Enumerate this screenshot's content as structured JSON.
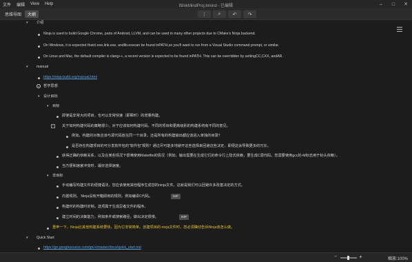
{
  "menubar": {
    "items": [
      "文件",
      "编辑",
      "View",
      "Help"
    ],
    "title": "BlinkMindProj.bmind - 已编辑"
  },
  "toolbar": {
    "tab_mindmap": "思维导图",
    "tab_outline": "大纲"
  },
  "outline": {
    "intro_title": "介绍",
    "intro_lines": [
      "Ninja is used to build Google Chrome, parts of Android, LLVM, and can be used in many other projects due to CMake's Ninja backend.",
      "On Windows, it is expected thatcl.exe,link.exe, andlib.execan be found inPATH,so you'll want to run from a Visual Studio command prompt, or similar.",
      "On Linux and Mac, the default compiler is clang++, a recent version is expected to be found inPATH. This can be overridden by settingCC,CXX, andAR."
    ],
    "manual_title": "manual",
    "manual_link": "https://ninja-build.org/manual.html",
    "philosophy": "哲学思想",
    "design_goals": "设计目标",
    "goal": "目标",
    "goal_lines": [
      "即使是非常大的项目，也可以非常快速（即瞬时）的增量构建。",
      "关于如何构建代码的策略很少。对于应该如何构建代码，不同的项目和更高级别的构建系统有不同的意见。",
      "例如，构建的对象应该与源代码放在同一个目录，还是所有的构建输出都应该进入单独的目录？",
      "是否存在构建项目的可分发软件包的“软件包”规则？通过尽可能多地避开这些选择来回避这些决定，即便这会导致更多的冗长。",
      "获得正确的依赖关系，以及在某些情况下很难使用Makefile的情况（例如，输出需要在生成它们的命令行上隐式依赖，要生成C源代码，您需要使用gcc的-M标志用于标头依赖）。",
      "当方便和速度冲突时，最好选择速度。"
    ],
    "nongoal": "非目标",
    "nongoal_lines": [
      "手动编写构建文件的便捷语法，您应该使用其他程序生成您的ninja文件。这就是我们可以回避许多改善决定的方式。",
      "内置规则。 Ninja没有开箱即用的规则，例如编译C代码。",
      "构建时的构建时定制。选项属于生成忍者文件的程序。",
      "建立时间的决策能力，例如条件或搜索路径。做出决定很慢。"
    ],
    "tag_label": "IMP",
    "yellow_line": "重申一下，Ninja比其他构建系统要快，因为它非常简单。创建项目的.ninja文件时，您必须确切告诉Ninja该怎么做。",
    "quickstart_title": "Quick Start",
    "quickstart_link": "https://gn.googlesource.com/gn/+/master/docs/quick_start.md"
  },
  "statusbar": {
    "zoom_label": "缩放:100%",
    "zoom_percent": 100
  },
  "colors": {
    "link": "#5aa0e6",
    "highlight": "#e6c22e",
    "background": "#1c1c1c"
  }
}
